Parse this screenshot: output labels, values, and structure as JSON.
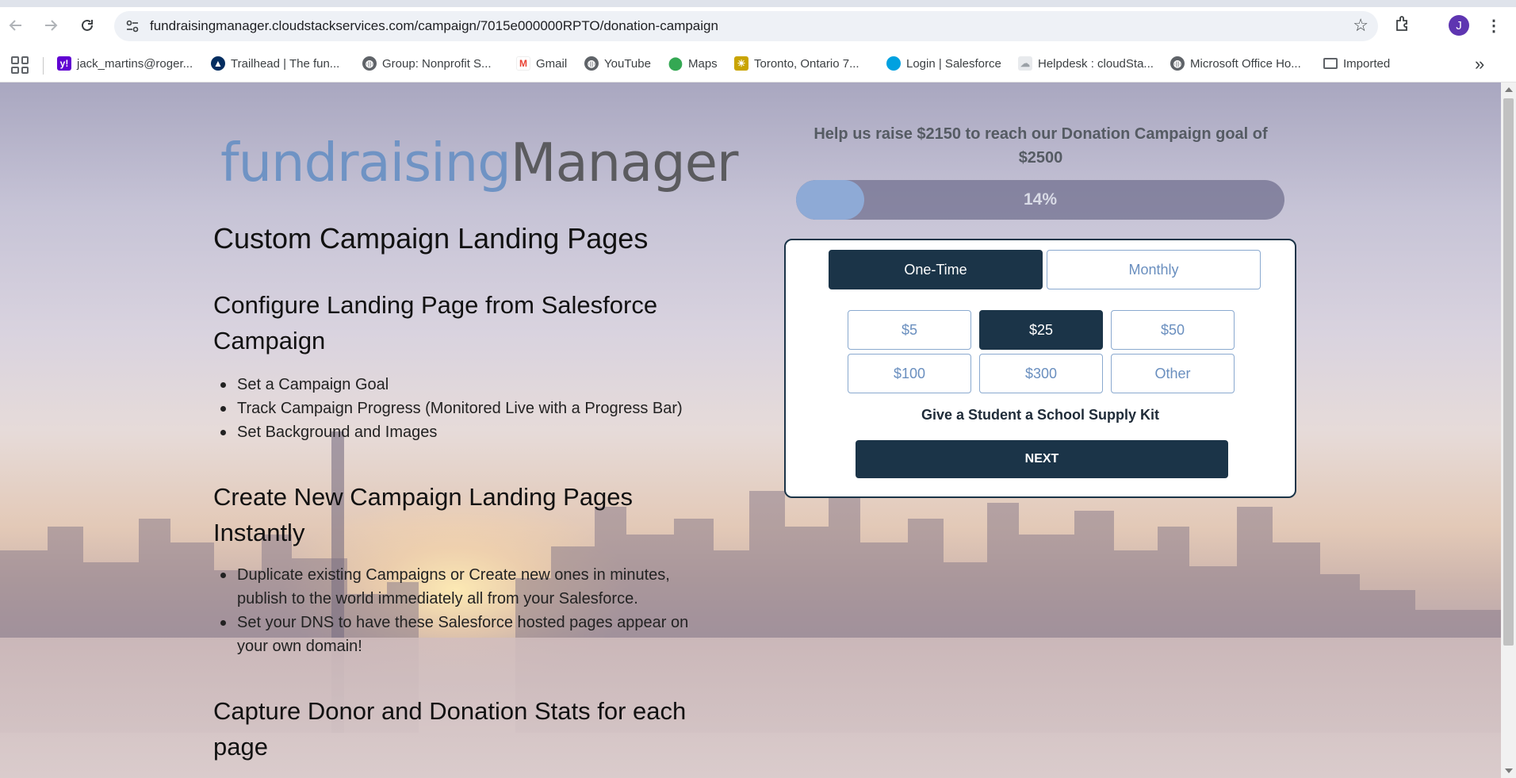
{
  "browser": {
    "url": "fundraisingmanager.cloudstackservices.com/campaign/7015e000000RPTO/donation-campaign",
    "profile_initial": "J",
    "bookmarks": [
      {
        "label": "jack_martins@roger...",
        "icon": "yahoo-icon",
        "color": "#6001d2"
      },
      {
        "label": "Trailhead | The fun...",
        "icon": "trailhead-icon",
        "color": "#032d60"
      },
      {
        "label": "Group: Nonprofit S...",
        "icon": "globe-icon",
        "color": "#5f6368"
      },
      {
        "label": "Gmail",
        "icon": "gmail-icon",
        "color": "#ea4335"
      },
      {
        "label": "YouTube",
        "icon": "globe-icon",
        "color": "#5f6368"
      },
      {
        "label": "Maps",
        "icon": "maps-icon",
        "color": "#34a853"
      },
      {
        "label": "Toronto, Ontario 7...",
        "icon": "weather-icon",
        "color": "#c9a400"
      },
      {
        "label": "Login | Salesforce",
        "icon": "salesforce-icon",
        "color": "#00a1e0"
      },
      {
        "label": "Helpdesk : cloudSta...",
        "icon": "cloud-icon",
        "color": "#9aa0a6"
      },
      {
        "label": "Microsoft Office Ho...",
        "icon": "globe-icon",
        "color": "#5f6368"
      },
      {
        "label": "Imported",
        "icon": "folder-icon",
        "color": "#5f6368"
      }
    ]
  },
  "page": {
    "logo": {
      "part1": "fundraising",
      "part2": "Manager"
    },
    "heading_main": "Custom Campaign Landing Pages",
    "sections": [
      {
        "heading": "Configure Landing Page from Salesforce Campaign",
        "bullets": [
          "Set a Campaign Goal",
          "Track Campaign Progress (Monitored Live with a Progress Bar)",
          "Set Background and Images"
        ]
      },
      {
        "heading": "Create New Campaign Landing Pages Instantly",
        "bullets": [
          "Duplicate existing Campaigns or Create new ones in minutes, publish to the world immediately all from your Salesforce.",
          "Set your DNS to have these Salesforce hosted pages appear on your own domain!"
        ]
      },
      {
        "heading": "Capture Donor and Donation Stats for each page"
      }
    ]
  },
  "donation": {
    "goal_text": "Help us raise $2150 to reach our Donation Campaign goal of $2500",
    "progress_label": "14%",
    "progress_value": 0.14,
    "frequency": {
      "one_time": "One-Time",
      "monthly": "Monthly",
      "selected": "one_time"
    },
    "amounts": [
      "$5",
      "$25",
      "$50",
      "$100",
      "$300",
      "Other"
    ],
    "selected_amount": "$25",
    "description": "Give a Student a School Supply Kit",
    "next_label": "NEXT"
  },
  "colors": {
    "accent_dark": "#1b3448",
    "accent_light": "#6a8fbf"
  }
}
